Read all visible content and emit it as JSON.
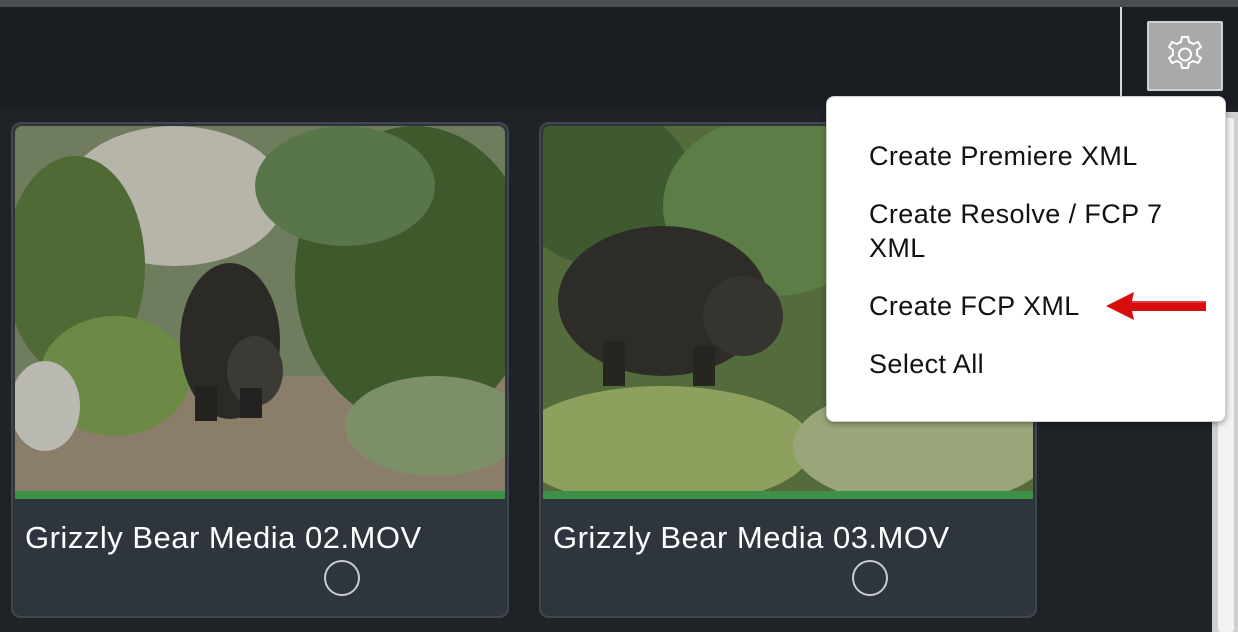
{
  "settings": {
    "button_icon": "gear-icon"
  },
  "menu": {
    "items": [
      {
        "label": "Create Premiere XML"
      },
      {
        "label": "Create Resolve / FCP 7 XML"
      },
      {
        "label": "Create FCP XML"
      },
      {
        "label": "Select All"
      }
    ],
    "annotation_color": "#d80d0d"
  },
  "clips": [
    {
      "title": "Grizzly Bear Media 02.MOV"
    },
    {
      "title": "Grizzly Bear Media 03.MOV"
    }
  ],
  "colors": {
    "progress": "#3e8f47",
    "background": "#1d2126",
    "card": "#2f353d"
  }
}
